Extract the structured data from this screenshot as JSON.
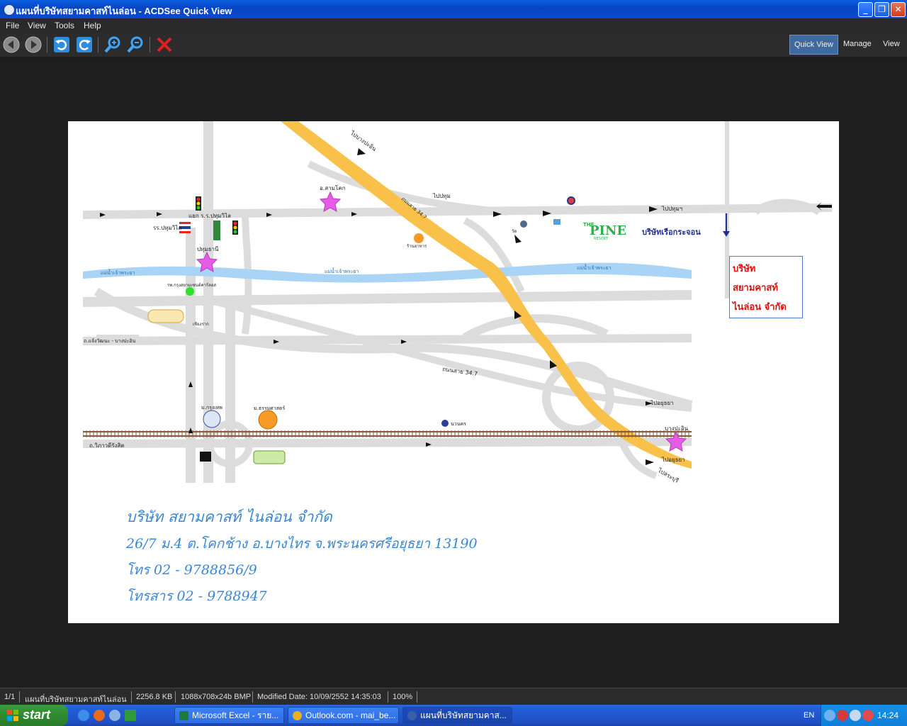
{
  "window": {
    "title": "แผนที่บริษัทสยามคาสท์ไนล่อน - ACDSee Quick View",
    "minimize": "_",
    "restore": "❐",
    "close": "✕"
  },
  "menu": [
    "File",
    "View",
    "Tools",
    "Help"
  ],
  "modes": {
    "quick_view": "Quick View",
    "manage": "Manage",
    "view": "View"
  },
  "map": {
    "address": {
      "company": "บริษัท สยามคาสท์ ไนล่อน จำกัด",
      "street": "26/7 ม.4 ต.โคกช้าง อ.บางไทร จ.พระนครศรีอยุธยา 13190",
      "phone": "โทร 02 - 9788856/9",
      "fax": "โทรสาร 02 - 9788947"
    },
    "callout": [
      "บริษัท",
      "สยามคาสท์",
      "ไนล่อน จำกัด"
    ],
    "labels": {
      "pine": "PINE",
      "pine_the": "THE",
      "pine_resort": "RESORT",
      "boat_company": "บริษัทเรือกระจอน",
      "river1": "แม่น้ำเจ้าพระยา",
      "river2": "แม่น้ำเจ้าพระยา",
      "river3": "แม่น้ำเจ้าพระยา",
      "road_347": "ถนนสาย 34.7",
      "to_bangpain_top": "ไปบางปะอิน",
      "to_pathum": "ไปปทุม",
      "to_pathum2": "ไปปทุมฯ",
      "to_ayutthaya1": "ไปอยุธยา",
      "to_ayutthaya2": "ไปอยุธยา",
      "to_saraburi": "ไปสระบุรี",
      "bangpain": "บางปะอิน",
      "samkhok": "อ.สามโคก",
      "pathumthani": "ปทุมธานี",
      "school": "รร.ปทุมวิไล",
      "hospital": "รพ.กรุงสยามเซนต์คาร์ลอส",
      "junction": "แยก ร.ร.ปทุมวิไล",
      "chiangrak": "เชียงราก",
      "rangsit_road": "ถ.วิภาวดีรังสิต",
      "changwattana": "ถ.แจ้งวัฒนะ - บางปะอิน",
      "krungthep_u": "ม.กรุงเทพ",
      "thammasat": "ม.ธรรมศาสตร์",
      "navanakorn": "นวนคร",
      "restaurant": "ร้านอาหาร",
      "temple": "วัด"
    }
  },
  "status": {
    "index": "1/1",
    "filename": "แผนที่บริษัทสยามคาสท์ไนล่อน",
    "size": "2256.8 KB",
    "dims": "1088x708x24b BMP",
    "modified": "Modified Date: 10/09/2552 14:35:03",
    "zoom": "100%"
  },
  "taskbar": {
    "start": "start",
    "tasks": [
      {
        "label": "Microsoft Excel - ราย...",
        "color": "#1d7a3a"
      },
      {
        "label": "Outlook.com - mai_be...",
        "color": "#e9b21c"
      },
      {
        "label": "แผนที่บริษัทสยามคาส...",
        "color": "#3a5fa8"
      }
    ],
    "language": "EN",
    "clock": "14:24"
  },
  "colors": {
    "accent": "#0a5fe0",
    "highway": "#f9c04a",
    "river": "#a9d4f5",
    "road": "#dcdcdc",
    "address_text": "#3a86d6"
  }
}
